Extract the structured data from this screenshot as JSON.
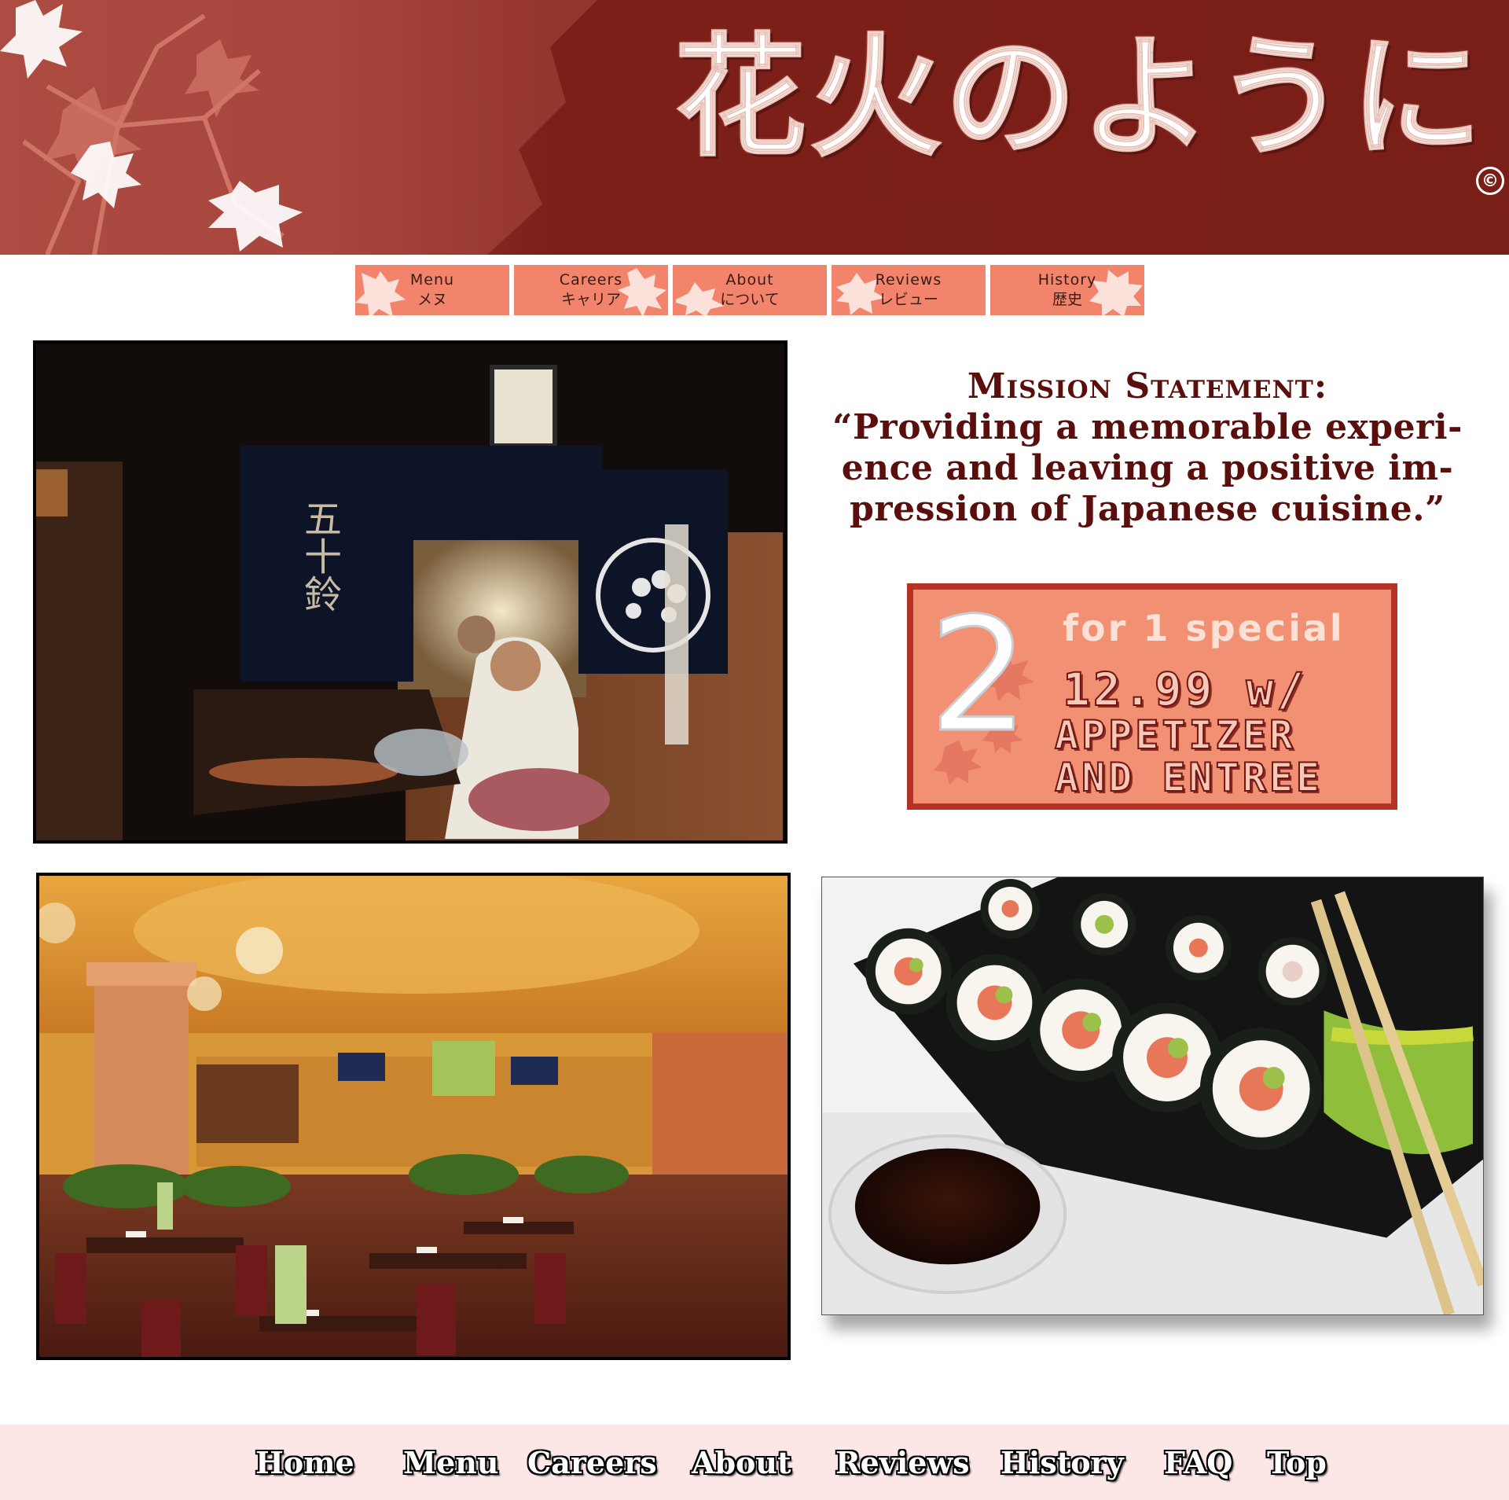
{
  "header": {
    "brand_title": "花火のように",
    "copyright_symbol": "©"
  },
  "top_nav": [
    {
      "label": "Menu",
      "label_jp": "メヌ"
    },
    {
      "label": "Careers",
      "label_jp": "キャリア"
    },
    {
      "label": "About",
      "label_jp": "について"
    },
    {
      "label": "Reviews",
      "label_jp": "レビュー"
    },
    {
      "label": "History",
      "label_jp": "歴史"
    }
  ],
  "mission": {
    "title": "Mission Statement:",
    "quote_line1": "“Providing a memorable experi-",
    "quote_line2": "ence and leaving a positive im-",
    "quote_line3": "pression of Japanese cuisine.”"
  },
  "special": {
    "number": "2",
    "heading": "for 1 special",
    "price": "12.99 w/",
    "line1": "APPETIZER",
    "line2": "AND ENTREE"
  },
  "photos": {
    "yakitori_sign": "五十鈴"
  },
  "footer_nav": [
    "Home",
    "Menu",
    "Careers",
    "About",
    "Reviews",
    "History",
    "FAQ",
    "Top"
  ],
  "colors": {
    "banner": "#7a1e18",
    "tab": "#f2846b",
    "mission_text": "#5a0f0c",
    "special_bg": "#f29074",
    "special_border": "#b53325",
    "footer_bg": "#fce6e6"
  }
}
